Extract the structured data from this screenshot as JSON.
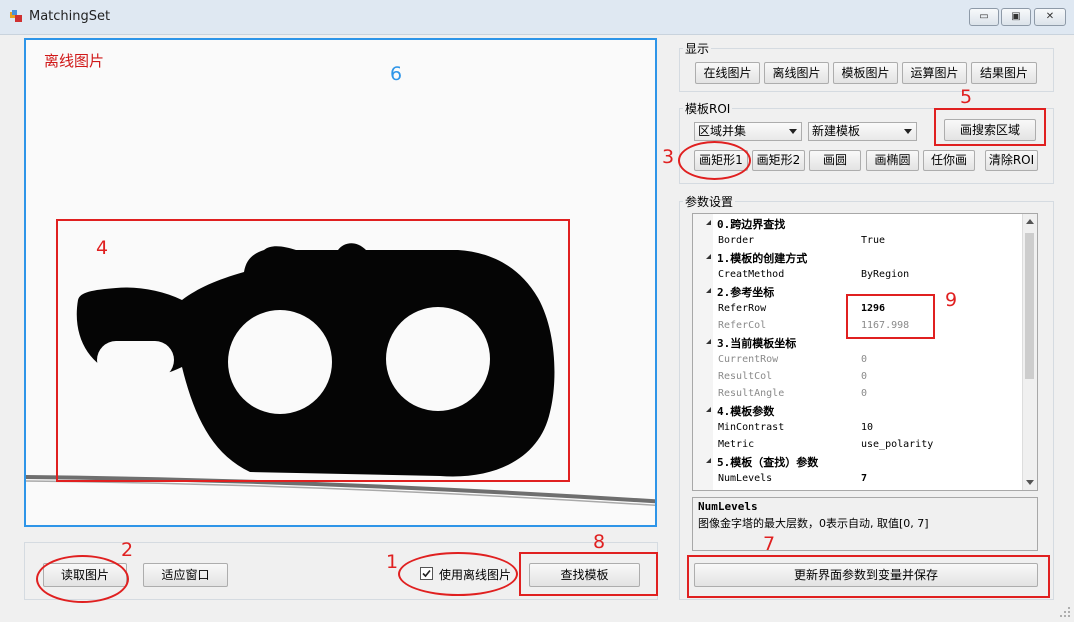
{
  "window": {
    "title": "MatchingSet",
    "minimize": "▭",
    "maximize": "▣",
    "close": "✕"
  },
  "image_panel": {
    "caption": "离线图片"
  },
  "bottom_left": {
    "read_image": "读取图片",
    "fit_window": "适应窗口",
    "use_offline": "使用离线图片",
    "use_offline_checked": true,
    "find_template": "查找模板"
  },
  "display": {
    "label": "显示",
    "buttons": [
      "在线图片",
      "离线图片",
      "模板图片",
      "运算图片",
      "结果图片"
    ]
  },
  "roi": {
    "label": "模板ROI",
    "combo1": "区域并集",
    "combo2": "新建模板",
    "search_area": "画搜索区域",
    "buttons": [
      "画矩形1",
      "画矩形2",
      "画圆",
      "画椭圆",
      "任你画",
      "清除ROI"
    ]
  },
  "params": {
    "label": "参数设置",
    "items": [
      {
        "type": "cat",
        "label": "0.跨边界查找"
      },
      {
        "type": "row",
        "name": "Border",
        "value": "True",
        "dim": false,
        "bold": false
      },
      {
        "type": "cat",
        "label": "1.模板的创建方式"
      },
      {
        "type": "row",
        "name": "CreatMethod",
        "value": "ByRegion",
        "dim": false,
        "bold": false
      },
      {
        "type": "cat",
        "label": "2.参考坐标"
      },
      {
        "type": "row",
        "name": "ReferRow",
        "value": "1296",
        "dim": false,
        "bold": true
      },
      {
        "type": "row",
        "name": "ReferCol",
        "value": "1167.998",
        "dim": true,
        "bold": false
      },
      {
        "type": "cat",
        "label": "3.当前模板坐标"
      },
      {
        "type": "row",
        "name": "CurrentRow",
        "value": "0",
        "dim": true,
        "bold": false
      },
      {
        "type": "row",
        "name": "ResultCol",
        "value": "0",
        "dim": true,
        "bold": false
      },
      {
        "type": "row",
        "name": "ResultAngle",
        "value": "0",
        "dim": true,
        "bold": false
      },
      {
        "type": "cat",
        "label": "4.模板参数"
      },
      {
        "type": "row",
        "name": "MinContrast",
        "value": "10",
        "dim": false,
        "bold": false
      },
      {
        "type": "row",
        "name": "Metric",
        "value": "use_polarity",
        "dim": false,
        "bold": false
      },
      {
        "type": "cat",
        "label": "5.模板（查找）参数"
      },
      {
        "type": "row",
        "name": "NumLevels",
        "value": "7",
        "dim": false,
        "bold": true
      }
    ],
    "description_title": "NumLevels",
    "description_text": "图像金字塔的最大层数，0表示自动, 取值[0, 7]",
    "save_button": "更新界面参数到变量并保存"
  },
  "annotations": {
    "n1": "1",
    "n2": "2",
    "n3": "3",
    "n4": "4",
    "n5": "5",
    "n6": "6",
    "n7": "7",
    "n8": "8",
    "n9": "9"
  }
}
